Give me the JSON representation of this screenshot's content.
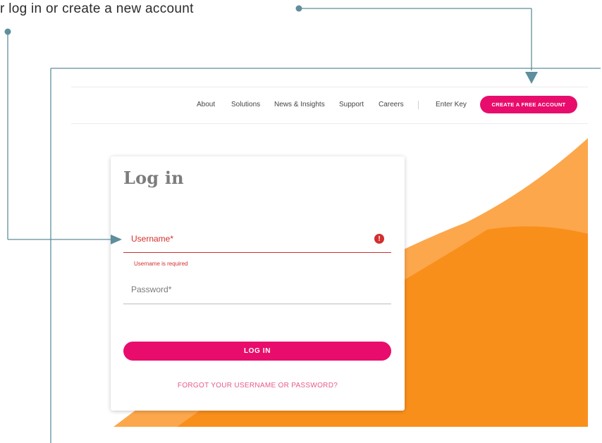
{
  "annotation": {
    "caption": "r log in or create a new account",
    "line_color": "#5f8e9c"
  },
  "nav": {
    "items": [
      "About",
      "Solutions",
      "News & Insights",
      "Support",
      "Careers"
    ],
    "enter_key": "Enter Key",
    "cta_label": "CREATE A FREE ACCOUNT"
  },
  "login": {
    "title": "Log in",
    "username_label": "Username*",
    "username_error": "Username is required",
    "password_label": "Password*",
    "button_label": "LOG IN",
    "forgot_link": "FORGOT YOUR USERNAME OR PASSWORD?"
  },
  "colors": {
    "brand_pink": "#e80d6c",
    "error_red": "#d32f2f",
    "hero_orange_light": "#fca74c",
    "hero_orange": "#f98f1b"
  },
  "icons": {
    "error": "exclamation-circle-icon"
  }
}
